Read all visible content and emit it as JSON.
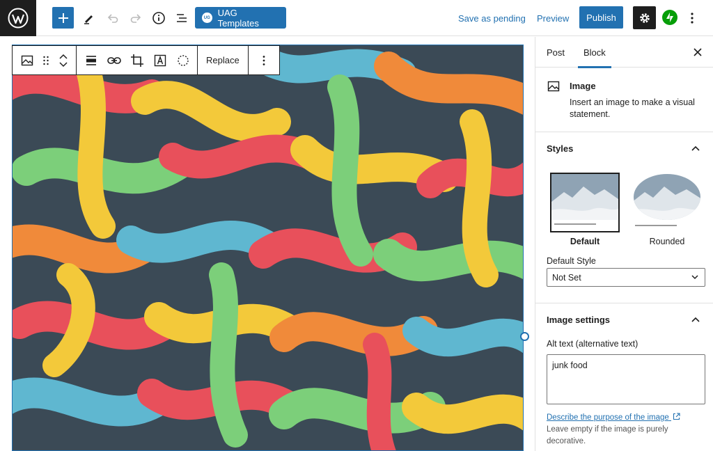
{
  "topbar": {
    "uag_label": "UAG Templates",
    "uag_badge": "UG",
    "save_pending_label": "Save as pending",
    "preview_label": "Preview",
    "publish_label": "Publish"
  },
  "block_toolbar": {
    "replace_label": "Replace"
  },
  "sidebar": {
    "tabs": [
      {
        "label": "Post"
      },
      {
        "label": "Block"
      }
    ],
    "block_card": {
      "title": "Image",
      "description": "Insert an image to make a visual statement."
    },
    "styles": {
      "title": "Styles",
      "options": [
        {
          "label": "Default"
        },
        {
          "label": "Rounded"
        }
      ],
      "default_style_label": "Default Style",
      "default_style_value": "Not Set"
    },
    "image_settings": {
      "title": "Image settings",
      "alt_label": "Alt text (alternative text)",
      "alt_value": "junk food",
      "help_link": "Describe the purpose of the image",
      "help_text": "Leave empty if the image is purely decorative."
    }
  },
  "colors": {
    "accent": "#2271b1",
    "dark": "#1e1e1e",
    "jetpack": "#069e08"
  }
}
